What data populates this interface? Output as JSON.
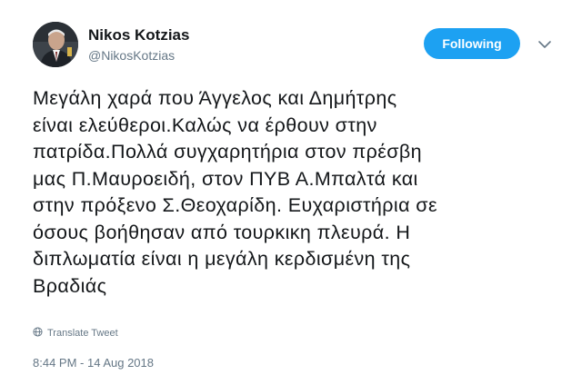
{
  "author": {
    "name": "Nikos Kotzias",
    "handle": "@NikosKotzias"
  },
  "follow_button": {
    "label": "Following",
    "color": "#1da1f2"
  },
  "menu_icon": "chevron-down-icon",
  "tweet": {
    "lines": [
      "Μεγάλη χαρά που Άγγελος και Δημήτρης",
      "είναι ελεύθεροι.Καλώς να έρθουν στην",
      "πατρίδα.Πολλά συγχαρητήρια στον πρέσβη",
      "μας Π.Μαυροειδή, στον ΠΥΒ Α.Μπαλτά και",
      "στην πρόξενο Σ.Θεοχαρίδη. Ευχαριστήρια σε",
      "όσους βοήθησαν από τουρκικη πλευρά. Η",
      "διπλωματία είναι η μεγάλη κερδισμένη της",
      "Βραδιάς"
    ]
  },
  "translate": {
    "label": "Translate Tweet",
    "icon": "globe-icon"
  },
  "timestamp": "8:44 PM - 14 Aug 2018"
}
